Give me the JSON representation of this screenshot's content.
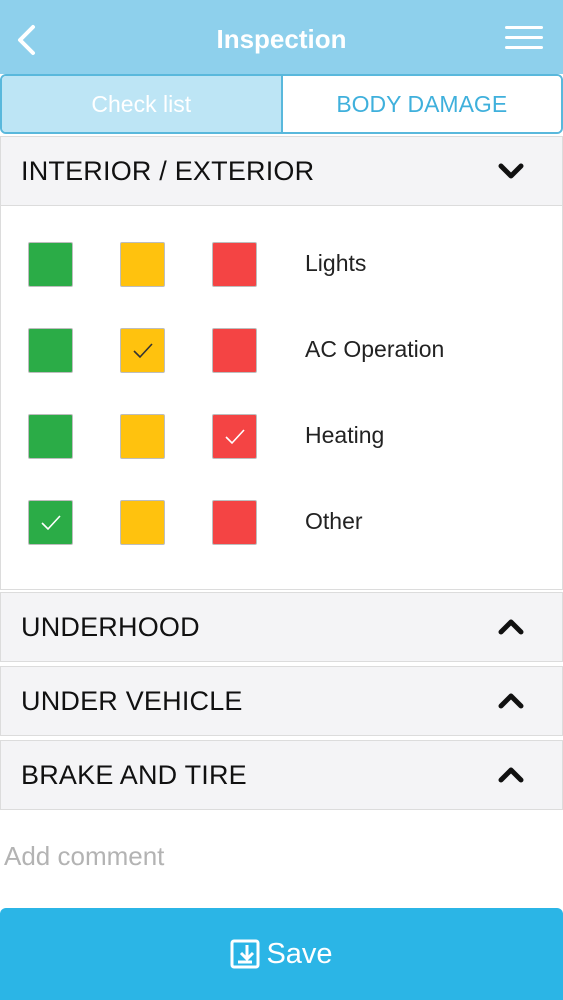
{
  "header": {
    "title": "Inspection",
    "back_icon": "chevron-left-icon",
    "menu_icon": "hamburger-menu-icon"
  },
  "tabs": [
    {
      "label": "Check list",
      "active": true
    },
    {
      "label": "BODY DAMAGE",
      "active": false
    }
  ],
  "sections": [
    {
      "title": "INTERIOR / EXTERIOR",
      "expanded": true,
      "items": [
        {
          "label": "Lights",
          "selected": ""
        },
        {
          "label": "AC Operation",
          "selected": "yellow"
        },
        {
          "label": "Heating",
          "selected": "red"
        },
        {
          "label": "Other",
          "selected": "green"
        }
      ]
    },
    {
      "title": "UNDERHOOD",
      "expanded": false
    },
    {
      "title": "UNDER VEHICLE",
      "expanded": false
    },
    {
      "title": "BRAKE AND TIRE",
      "expanded": false
    }
  ],
  "comment": {
    "placeholder": "Add comment",
    "value": ""
  },
  "save": {
    "label": "Save",
    "icon": "save-download-icon"
  },
  "colors": {
    "header_bg": "#8ed0ec",
    "accent": "#2bb5e6",
    "ok_green": "#2bac47",
    "warn_yellow": "#ffc20e",
    "bad_red": "#f44444"
  }
}
